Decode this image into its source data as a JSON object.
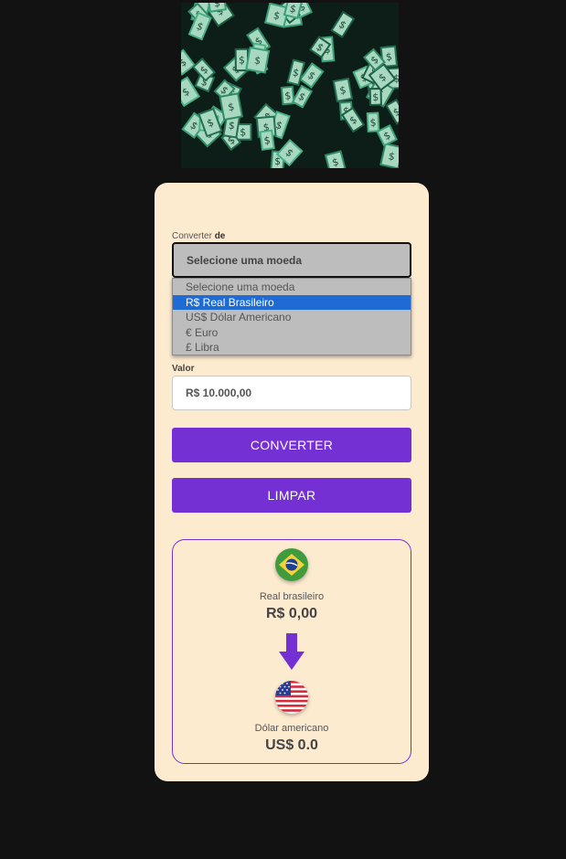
{
  "hero": {
    "image": "falling-dollar-bills"
  },
  "form": {
    "from_label_prefix": "Converter ",
    "from_label_bold": "de",
    "selected": "Selecione uma moeda",
    "options": [
      "Selecione uma moeda",
      "R$ Real Brasileiro",
      "US$ Dólar Americano",
      "€ Euro",
      "£ Libra"
    ],
    "highlighted_option": "R$ Real Brasileiro",
    "value_label": "Valor",
    "value": "R$ 10.000,00"
  },
  "buttons": {
    "convert": "CONVERTER",
    "clear": "LIMPAR"
  },
  "result": {
    "from": {
      "name": "Real brasileiro",
      "value": "R$ 0,00",
      "icon": "brazil-flag-icon"
    },
    "arrow_icon": "arrow-down-icon",
    "to": {
      "name": "Dólar americano",
      "value": "US$ 0.0",
      "icon": "usa-flag-icon"
    }
  },
  "colors": {
    "page_background": "#121212",
    "card_background": "#fdebd0",
    "accent": "#7530d4",
    "dropdown_highlight": "#1e6bd6"
  }
}
